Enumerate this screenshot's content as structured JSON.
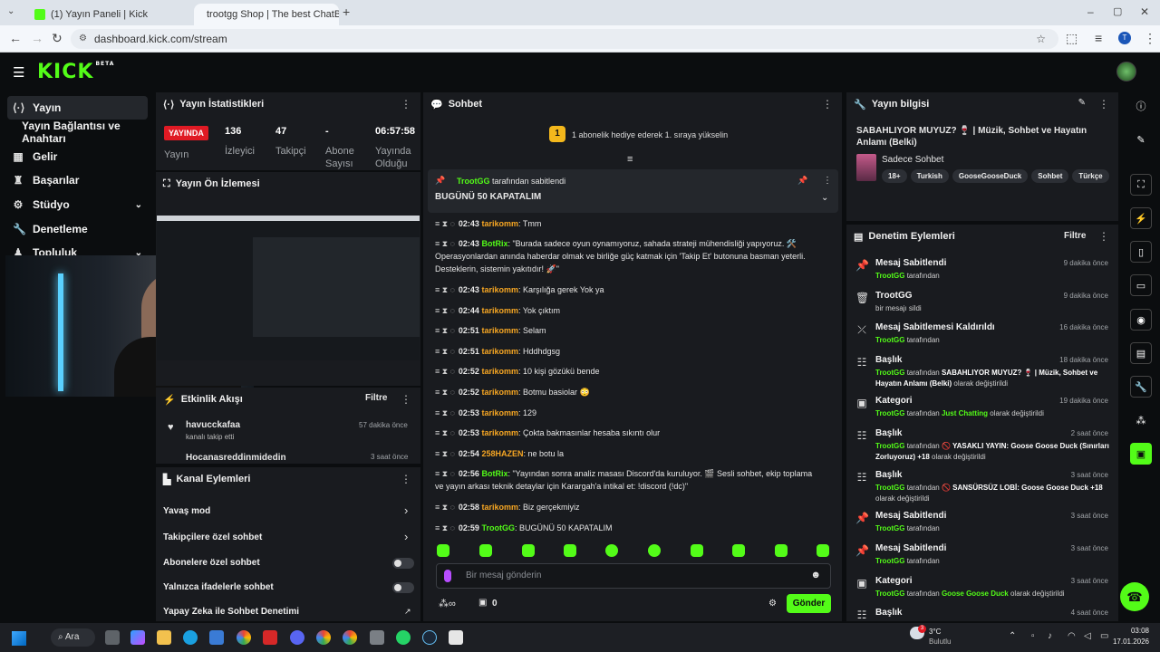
{
  "browser": {
    "tabs": [
      {
        "title": "(1) Yayın Paneli | Kick"
      },
      {
        "title": "trootgg Shop | The best ChatB"
      }
    ],
    "new_tab": "+",
    "url": "dashboard.kick.com/stream",
    "profile_initial": "T"
  },
  "nav": {
    "items": [
      {
        "label": "Yayın",
        "icon": "broadcast-icon",
        "active": true
      },
      {
        "label": "Yayın Bağlantısı ve Anahtarı",
        "icon": "",
        "active": false
      },
      {
        "label": "Gelir",
        "icon": "revenue-icon"
      },
      {
        "label": "Başarılar",
        "icon": "trophy-icon"
      },
      {
        "label": "Stüdyo",
        "icon": "studio-icon"
      },
      {
        "label": "Denetleme",
        "icon": "wrench-icon"
      },
      {
        "label": "Topluluk",
        "icon": "community-icon"
      }
    ]
  },
  "stats": {
    "title": "Yayın İstatistikleri",
    "live_label": "YAYINDA",
    "status_label": "Yayın",
    "viewers": "136",
    "viewers_label": "İzleyici",
    "followers": "47",
    "followers_label": "Takipçi",
    "subs": "-",
    "subs_label": "Abone Sayısı",
    "uptime": "06:57:58",
    "uptime_label": "Yayında Olduğu"
  },
  "preview": {
    "title": "Yayın Ön İzlemesi"
  },
  "activity": {
    "title": "Etkinlik Akışı",
    "filter": "Filtre",
    "items": [
      {
        "user": "havucckafaa",
        "text": "kanalı takip etti",
        "time": "57 dakika önce"
      },
      {
        "user": "Hocanasreddinmidedin",
        "text": "",
        "time": "3 saat önce"
      }
    ]
  },
  "channel_actions": {
    "title": "Kanal Eylemleri",
    "slow_mode": "Yavaş mod",
    "followers_only": "Takipçilere özel sohbet",
    "subs_only": "Abonelere özel sohbet",
    "emotes_only": "Yalnızca ifadelerle sohbet",
    "ai_mod": "Yapay Zeka ile Sohbet Denetimi"
  },
  "chat": {
    "title": "Sohbet",
    "gift_banner": "1 abonelik hediye ederek 1. sıraya yükselin",
    "gift_rank": "1",
    "pinned_by_user": "TrootGG",
    "pinned_by_suffix": "tarafından sabitlendi",
    "pinned_message": "BUGÜNÜ 50 KAPATALIM",
    "messages": [
      {
        "time": "02:43",
        "user": "tarikomm",
        "color": "#f6a623",
        "text": "Tmm"
      },
      {
        "time": "02:43",
        "user": "BotRix",
        "color": "#53fc18",
        "text": "\"Burada sadece oyun oynamıyoruz, sahada strateji mühendisliği yapıyoruz. 🛠️ Operasyonlardan anında haberdar olmak ve birliğe güç katmak için 'Takip Et' butonuna basman yeterli. Desteklerin, sistemin yakıtıdır! 🚀\""
      },
      {
        "time": "02:43",
        "user": "tarikomm",
        "color": "#f6a623",
        "text": "Karşılığa gerek Yok ya"
      },
      {
        "time": "02:44",
        "user": "tarikomm",
        "color": "#f6a623",
        "text": "Yok çıktım"
      },
      {
        "time": "02:51",
        "user": "tarikomm",
        "color": "#f6a623",
        "text": "Selam"
      },
      {
        "time": "02:51",
        "user": "tarikomm",
        "color": "#f6a623",
        "text": "Hddhdgsg"
      },
      {
        "time": "02:52",
        "user": "tarikomm",
        "color": "#f6a623",
        "text": "10 kişi gözükü bende"
      },
      {
        "time": "02:52",
        "user": "tarikomm",
        "color": "#f6a623",
        "text": "Botmu basiolar 😳"
      },
      {
        "time": "02:53",
        "user": "tarikomm",
        "color": "#f6a623",
        "text": "129"
      },
      {
        "time": "02:53",
        "user": "tarikomm",
        "color": "#f6a623",
        "text": "Çokta bakmasınlar hesaba sıkıntı olur"
      },
      {
        "time": "02:54",
        "user": "258HAZEN",
        "color": "#f6a623",
        "text": "ne botu la"
      },
      {
        "time": "02:56",
        "user": "BotRix",
        "color": "#53fc18",
        "text": "\"Yayından sonra analiz masası Discord'da kuruluyor. 🎬 Sesli sohbet, ekip toplama ve yayın arkası teknik detaylar için Karargah'a intikal et: !discord (!dc)\""
      },
      {
        "time": "02:58",
        "user": "tarikomm",
        "color": "#f6a623",
        "text": "Biz gerçekmiyiz"
      },
      {
        "time": "02:59",
        "user": "TrootGG",
        "color": "#53fc18",
        "text": "BUGÜNÜ 50 KAPATALIM"
      }
    ],
    "input_placeholder": "Bir mesaj gönderin",
    "points_value": "0",
    "send_label": "Gönder",
    "infinity": "∞"
  },
  "stream_info": {
    "title": "Yayın bilgisi",
    "stream_title": "SABAHLIYOR MUYUZ? 🍷 | Müzik, Sohbet ve Hayatın Anlamı (Belki)",
    "category": "Sadece Sohbet",
    "tags": [
      "18+",
      "Turkish",
      "GooseGooseDuck",
      "Sohbet",
      "Türkçe"
    ]
  },
  "mod_actions": {
    "title": "Denetim Eylemleri",
    "filter": "Filtre",
    "items": [
      {
        "icon": "pin-icon",
        "title": "Mesaj Sabitlendi",
        "user": "TrootGG",
        "suffix": "tarafından",
        "detail": "",
        "detail2": "",
        "time": "9 dakika önce"
      },
      {
        "icon": "trash-icon",
        "title": "TrootGG",
        "user": "",
        "suffix": "bir mesajı sildi",
        "detail": "",
        "detail2": "",
        "time": "9 dakika önce"
      },
      {
        "icon": "unpin-icon",
        "title": "Mesaj Sabitlemesi Kaldırıldı",
        "user": "TrootGG",
        "suffix": "tarafından",
        "detail": "",
        "detail2": "",
        "time": "16 dakika önce"
      },
      {
        "icon": "title-icon",
        "title": "Başlık",
        "user": "TrootGG",
        "suffix": "tarafından",
        "detail": "SABAHLIYOR MUYUZ? 🍷 | Müzik, Sohbet ve Hayatın Anlamı (Belki)",
        "detail2": "olarak değiştirildi",
        "time": "18 dakika önce"
      },
      {
        "icon": "category-icon",
        "title": "Kategori",
        "user": "TrootGG",
        "suffix": "tarafından",
        "detail": "Just Chatting",
        "detail2": "olarak değiştirildi",
        "time": "19 dakika önce"
      },
      {
        "icon": "title-icon",
        "title": "Başlık",
        "user": "TrootGG",
        "suffix": "tarafından",
        "detail": "🚫 YASAKLI YAYIN: Goose Goose Duck (Sınırları Zorluyoruz) +18",
        "detail2": "olarak değiştirildi",
        "time": "2 saat önce"
      },
      {
        "icon": "title-icon",
        "title": "Başlık",
        "user": "TrootGG",
        "suffix": "tarafından",
        "detail": "🚫 SANSÜRSÜZ LOBİ: Goose Goose Duck +18",
        "detail2": "olarak değiştirildi",
        "time": "3 saat önce"
      },
      {
        "icon": "pin-icon",
        "title": "Mesaj Sabitlendi",
        "user": "TrootGG",
        "suffix": "tarafından",
        "detail": "",
        "detail2": "",
        "time": "3 saat önce"
      },
      {
        "icon": "pin-icon",
        "title": "Mesaj Sabitlendi",
        "user": "TrootGG",
        "suffix": "tarafından",
        "detail": "",
        "detail2": "",
        "time": "3 saat önce"
      },
      {
        "icon": "category-icon",
        "title": "Kategori",
        "user": "TrootGG",
        "suffix": "tarafından",
        "detail": "Goose Goose Duck",
        "detail2": "olarak değiştirildi",
        "time": "3 saat önce"
      },
      {
        "icon": "title-icon",
        "title": "Başlık",
        "user": "",
        "suffix": "",
        "detail": "",
        "detail2": "",
        "time": "4 saat önce"
      }
    ]
  },
  "taskbar": {
    "search": "Ara",
    "weather_temp": "3°C",
    "weather_desc": "Bulutlu",
    "weather_badge": "3",
    "time": "03:08",
    "date": "17.01.2026"
  },
  "colors": {
    "accent": "#53fc18",
    "live": "#e01a24",
    "username": "#f6a623"
  }
}
